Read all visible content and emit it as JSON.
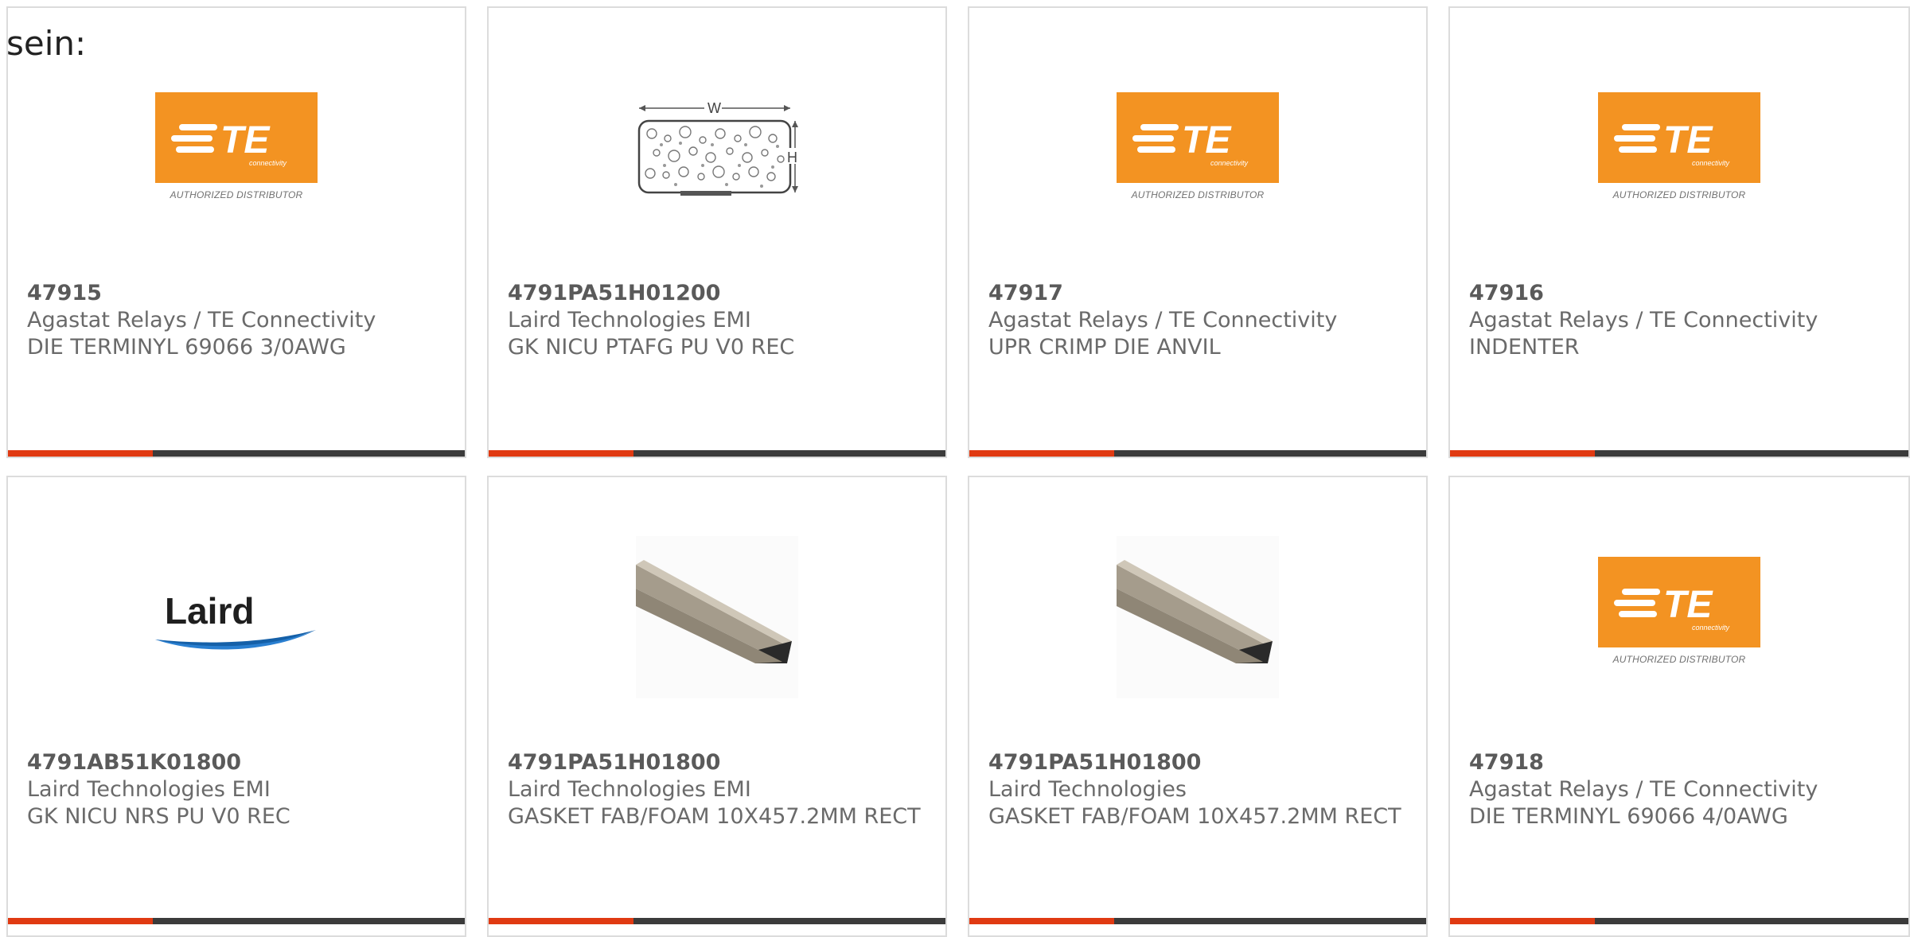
{
  "page": {
    "intro_text": "sein:"
  },
  "logos": {
    "te_caption": "AUTHORIZED DISTRIBUTOR",
    "te_subtext": "connectivity",
    "te_letters": "TE",
    "laird_text": "Laird",
    "drawing_w": "W",
    "drawing_h": "H"
  },
  "colors": {
    "accent": "#e03a12",
    "bar": "#3b3b3b",
    "te_orange": "#f39322",
    "laird_blue": "#2a7fd0"
  },
  "products": [
    {
      "part_number": "47915",
      "manufacturer": "Agastat Relays / TE Connectivity",
      "description": "DIE TERMINYL 69066 3/0AWG",
      "image": "te-logo"
    },
    {
      "part_number": "4791PA51H01200",
      "manufacturer": "Laird Technologies EMI",
      "description": "GK NICU PTAFG PU V0 REC",
      "image": "dimension-drawing"
    },
    {
      "part_number": "47917",
      "manufacturer": "Agastat Relays / TE Connectivity",
      "description": "UPR CRIMP DIE ANVIL",
      "image": "te-logo"
    },
    {
      "part_number": "47916",
      "manufacturer": "Agastat Relays / TE Connectivity",
      "description": "INDENTER",
      "image": "te-logo"
    },
    {
      "part_number": "4791AB51K01800",
      "manufacturer": "Laird Technologies EMI",
      "description": "GK NICU NRS PU V0 REC",
      "image": "laird-logo"
    },
    {
      "part_number": "4791PA51H01800",
      "manufacturer": "Laird Technologies EMI",
      "description": "GASKET FAB/FOAM 10X457.2MM RECT",
      "image": "gasket-photo"
    },
    {
      "part_number": "4791PA51H01800",
      "manufacturer": "Laird Technologies",
      "description": "GASKET FAB/FOAM 10X457.2MM RECT",
      "image": "gasket-photo"
    },
    {
      "part_number": "47918",
      "manufacturer": "Agastat Relays / TE Connectivity",
      "description": "DIE TERMINYL 69066 4/0AWG",
      "image": "te-logo"
    }
  ]
}
